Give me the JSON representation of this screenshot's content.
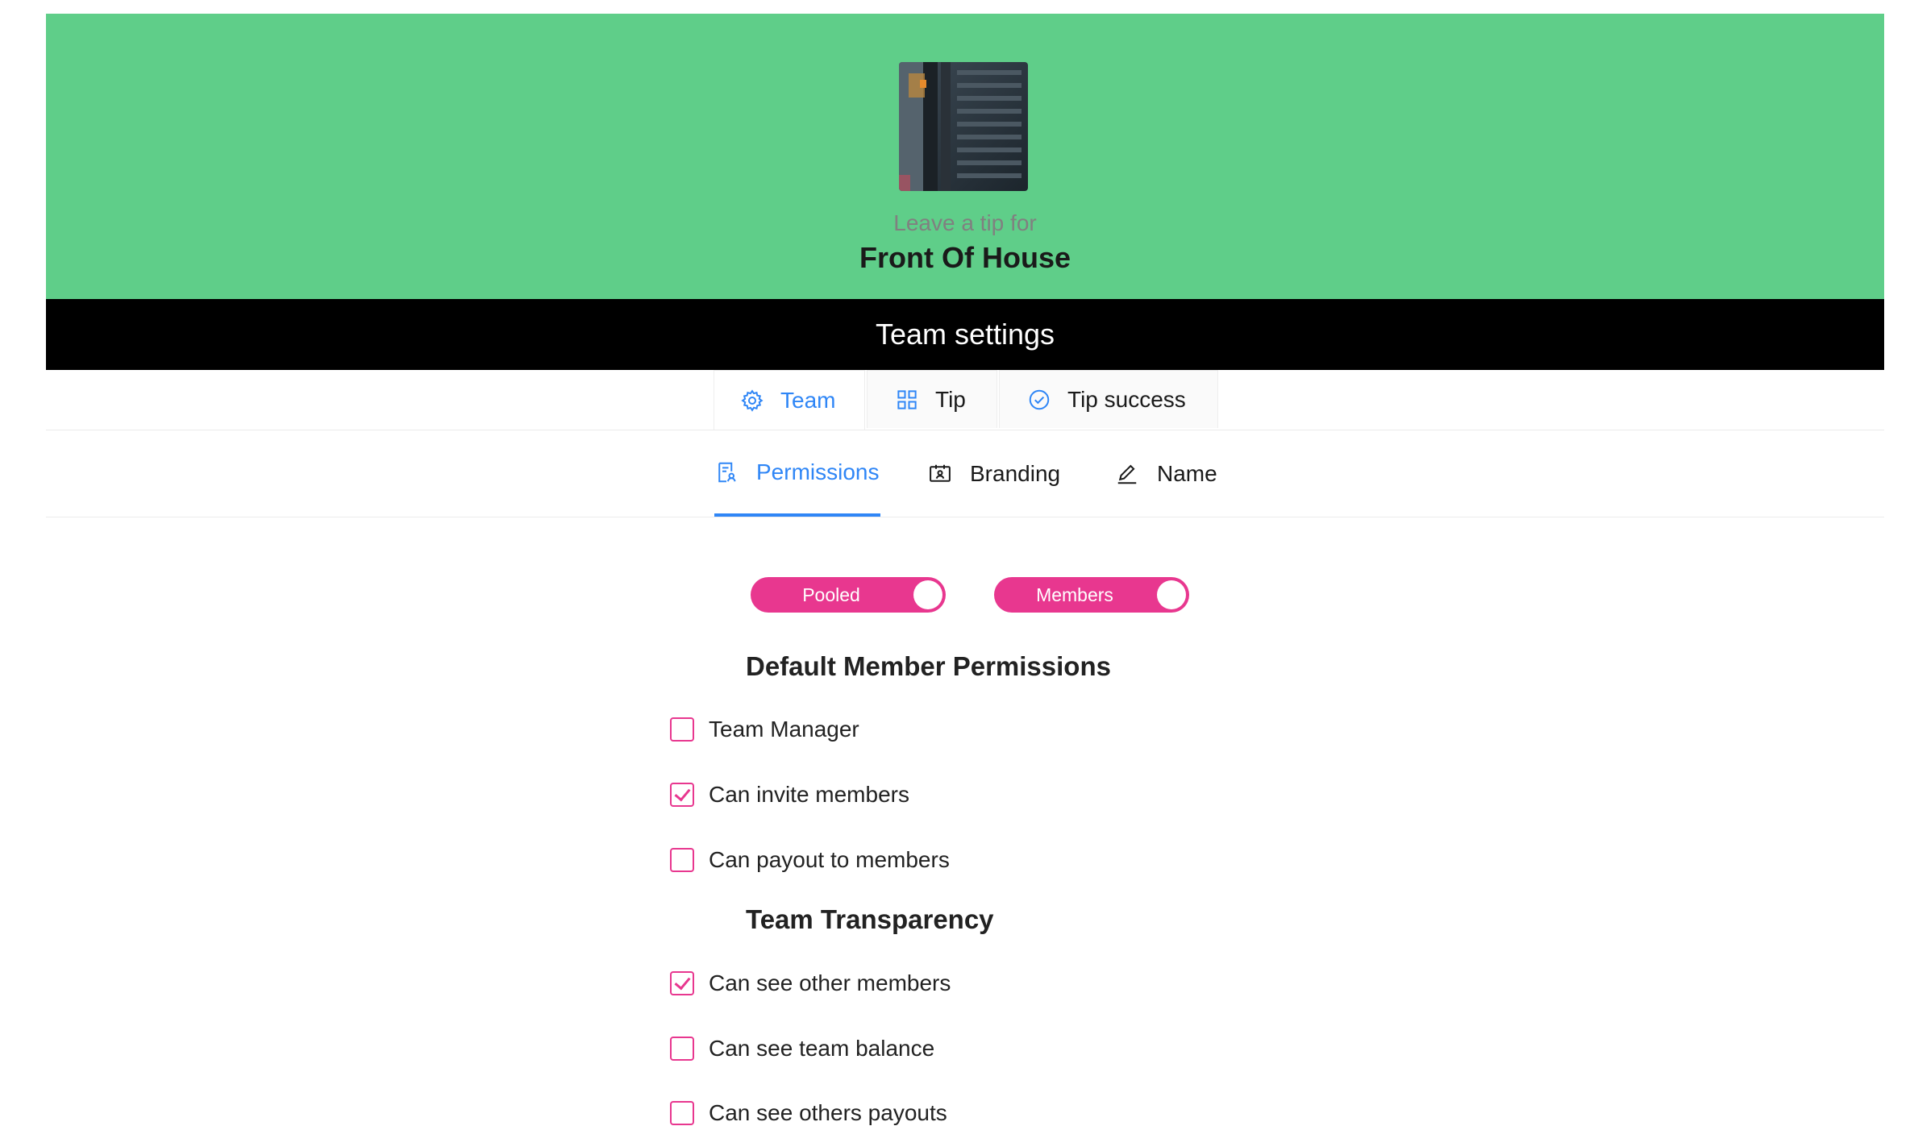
{
  "header": {
    "subtitle": "Leave a tip for",
    "team_name": "Front Of House",
    "banner": "Team settings"
  },
  "tabs": [
    {
      "label": "Team",
      "icon": "gear-icon",
      "active": true
    },
    {
      "label": "Tip",
      "icon": "grid-icon",
      "active": false
    },
    {
      "label": "Tip success",
      "icon": "check-circle-icon",
      "active": false
    }
  ],
  "subtabs": [
    {
      "label": "Permissions",
      "icon": "permissions-icon",
      "active": true
    },
    {
      "label": "Branding",
      "icon": "id-card-icon",
      "active": false
    },
    {
      "label": "Name",
      "icon": "edit-icon",
      "active": false
    }
  ],
  "toggles": [
    {
      "label": "Pooled",
      "on": true
    },
    {
      "label": "Members",
      "on": true
    }
  ],
  "default_permissions": {
    "title": "Default Member Permissions",
    "items": [
      {
        "label": "Team Manager",
        "checked": false
      },
      {
        "label": "Can invite members",
        "checked": true
      },
      {
        "label": "Can payout to members",
        "checked": false
      }
    ]
  },
  "transparency": {
    "title": "Team Transparency",
    "items": [
      {
        "label": "Can see other members",
        "checked": true
      },
      {
        "label": "Can see team balance",
        "checked": false
      },
      {
        "label": "Can see others payouts",
        "checked": false
      }
    ]
  },
  "colors": {
    "header_green": "#5fce89",
    "accent_blue": "#2f86f6",
    "toggle_pink": "#e8378f"
  }
}
